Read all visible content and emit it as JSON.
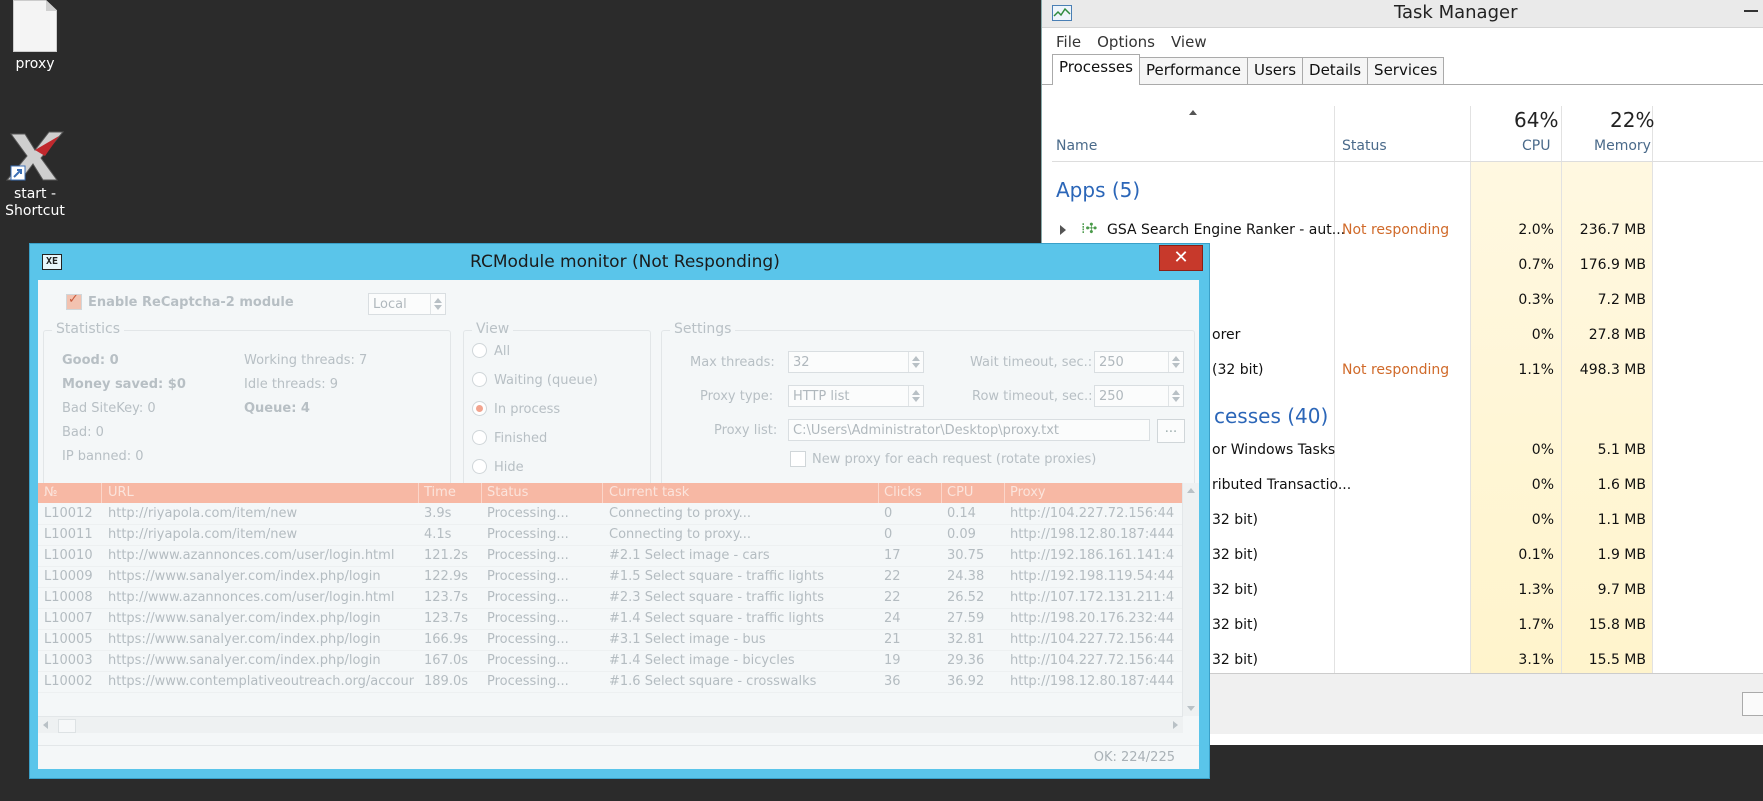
{
  "desktop": {
    "icons": [
      {
        "label": "proxy"
      },
      {
        "label": "start -\nShortcut"
      }
    ]
  },
  "task_manager": {
    "title": "Task Manager",
    "menu": [
      "File",
      "Options",
      "View"
    ],
    "tabs": [
      "Processes",
      "Performance",
      "Users",
      "Details",
      "Services"
    ],
    "headers": {
      "name": "Name",
      "status": "Status",
      "cpu_pct": "64%",
      "cpu": "CPU",
      "mem_pct": "22%",
      "memory": "Memory"
    },
    "groups": {
      "apps": "Apps (5)",
      "background": "cesses (40)"
    },
    "rows": [
      {
        "name": "GSA Search Engine Ranker - aut...",
        "status": "Not responding",
        "cpu": "2.0%",
        "mem": "236.7 MB"
      },
      {
        "name": "",
        "status": "",
        "cpu": "0.7%",
        "mem": "176.9 MB"
      },
      {
        "name": "",
        "status": "",
        "cpu": "0.3%",
        "mem": "7.2 MB"
      },
      {
        "name": "orer",
        "status": "",
        "cpu": "0%",
        "mem": "27.8 MB"
      },
      {
        "name": "(32 bit)",
        "status": "Not responding",
        "cpu": "1.1%",
        "mem": "498.3 MB"
      },
      {
        "name": "or Windows Tasks",
        "status": "",
        "cpu": "0%",
        "mem": "5.1 MB"
      },
      {
        "name": "ributed Transactio...",
        "status": "",
        "cpu": "0%",
        "mem": "1.6 MB"
      },
      {
        "name": "32 bit)",
        "status": "",
        "cpu": "0%",
        "mem": "1.1 MB"
      },
      {
        "name": "32 bit)",
        "status": "",
        "cpu": "0.1%",
        "mem": "1.9 MB"
      },
      {
        "name": "32 bit)",
        "status": "",
        "cpu": "1.3%",
        "mem": "9.7 MB"
      },
      {
        "name": "32 bit)",
        "status": "",
        "cpu": "1.7%",
        "mem": "15.8 MB"
      },
      {
        "name": "32 bit)",
        "status": "",
        "cpu": "3.1%",
        "mem": "15.5 MB"
      }
    ]
  },
  "rc": {
    "title": "RCModule monitor (Not Responding)",
    "icon_text": "XE",
    "close": "✕",
    "enable_label": "Enable ReCaptcha-2 module",
    "mode": "Local",
    "statistics": {
      "legend": "Statistics",
      "good": "Good: 0",
      "money_saved": "Money saved: $0",
      "bad_sitekey": "Bad SiteKey: 0",
      "bad": "Bad: 0",
      "ip_banned": "IP banned: 0",
      "working_threads": "Working threads: 7",
      "idle_threads": "Idle threads: 9",
      "queue": "Queue: 4"
    },
    "view": {
      "legend": "View",
      "options": [
        "All",
        "Waiting (queue)",
        "In process",
        "Finished",
        "Hide"
      ]
    },
    "settings": {
      "legend": "Settings",
      "max_threads_label": "Max threads:",
      "max_threads": "32",
      "proxy_type_label": "Proxy type:",
      "proxy_type": "HTTP list",
      "proxy_list_label": "Proxy list:",
      "proxy_list": "C:\\Users\\Administrator\\Desktop\\proxy.txt",
      "browse": "...",
      "wait_timeout_label": "Wait timeout, sec.:",
      "wait_timeout": "250",
      "row_timeout_label": "Row timeout, sec.:",
      "row_timeout": "250",
      "rotate_label": "New proxy for each request (rotate proxies)"
    },
    "grid": {
      "columns": [
        "№",
        "URL",
        "Time",
        "Status",
        "Current task",
        "Clicks",
        "CPU",
        "Proxy"
      ],
      "rows": [
        [
          "L10012",
          "http://riyapola.com/item/new",
          "3.9s",
          "Processing...",
          "Connecting to proxy...",
          "0",
          "0.14",
          "http://104.227.72.156:44"
        ],
        [
          "L10011",
          "http://riyapola.com/item/new",
          "4.1s",
          "Processing...",
          "Connecting to proxy...",
          "0",
          "0.09",
          "http://198.12.80.187:444"
        ],
        [
          "L10010",
          "http://www.azannonces.com/user/login.html",
          "121.2s",
          "Processing...",
          "#2.1 Select image - cars",
          "17",
          "30.75",
          "http://192.186.161.141:4"
        ],
        [
          "L10009",
          "https://www.sanalyer.com/index.php/login",
          "122.9s",
          "Processing...",
          "#1.5 Select square - traffic lights",
          "22",
          "24.38",
          "http://192.198.119.54:44"
        ],
        [
          "L10008",
          "http://www.azannonces.com/user/login.html",
          "123.7s",
          "Processing...",
          "#2.3 Select square - traffic lights",
          "22",
          "26.52",
          "http://107.172.131.211:4"
        ],
        [
          "L10007",
          "https://www.sanalyer.com/index.php/login",
          "123.7s",
          "Processing...",
          "#1.4 Select square - traffic lights",
          "24",
          "27.59",
          "http://198.20.176.232:44"
        ],
        [
          "L10005",
          "https://www.sanalyer.com/index.php/login",
          "166.9s",
          "Processing...",
          "#3.1 Select image - bus",
          "21",
          "32.81",
          "http://104.227.72.156:44"
        ],
        [
          "L10003",
          "https://www.sanalyer.com/index.php/login",
          "167.0s",
          "Processing...",
          "#1.4 Select image - bicycles",
          "19",
          "29.36",
          "http://104.227.72.156:44"
        ],
        [
          "L10002",
          "https://www.contemplativeoutreach.org/account/:",
          "189.0s",
          "Processing...",
          "#1.6 Select square - crosswalks",
          "36",
          "36.92",
          "http://198.12.80.187:444"
        ]
      ]
    },
    "status_bar": "OK: 224/225"
  }
}
